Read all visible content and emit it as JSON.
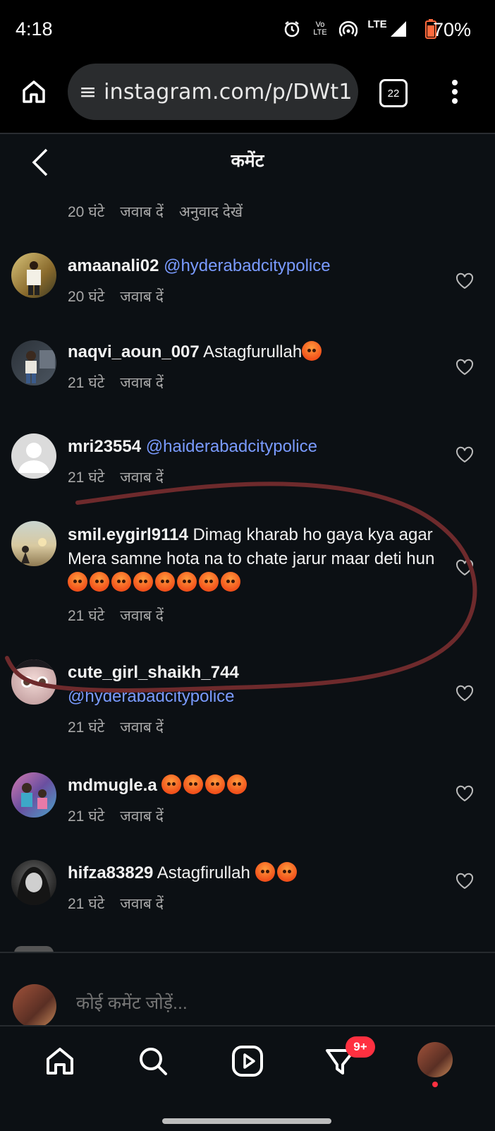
{
  "status_bar": {
    "time": "4:18",
    "volte": "Vo\nLTE",
    "lte": "LTE",
    "battery": "70%"
  },
  "browser": {
    "url": "≡ instagram.com/p/DWt1",
    "tabs_count": "22"
  },
  "header": {
    "title": "कमेंट"
  },
  "top_meta": {
    "time": "20 घंटे",
    "reply": "जवाब दें",
    "translate": "अनुवाद देखें"
  },
  "comments": [
    {
      "username": "amaanali02",
      "text": "",
      "mention": "@hyderabadcitypolice",
      "time": "20 घंटे",
      "reply": "जवाब दें"
    },
    {
      "username": "naqvi_aoun_007",
      "text": "Astagfurullah",
      "mention": "",
      "time": "21 घंटे",
      "reply": "जवाब दें",
      "emoji_count": 1
    },
    {
      "username": "mri23554",
      "text": "",
      "mention": "@haiderabadcitypolice",
      "time": "21 घंटे",
      "reply": "जवाब दें"
    },
    {
      "username": "smil.eygirl9114",
      "text": "Dimag kharab ho gaya kya agar Mera samne hota na to chate jarur maar deti hun",
      "mention": "",
      "time": "21 घंटे",
      "reply": "जवाब दें",
      "emoji_count": 8
    },
    {
      "username": "cute_girl_shaikh_744",
      "text": "",
      "mention": "@hyderabadcitypolice",
      "time": "21 घंटे",
      "reply": "जवाब दें"
    },
    {
      "username": "mdmugle.a",
      "text": "",
      "mention": "",
      "time": "21 घंटे",
      "reply": "जवाब दें",
      "emoji_count": 4
    },
    {
      "username": "hifza83829",
      "text": "Astagfirullah",
      "mention": "",
      "time": "21 घंटे",
      "reply": "जवाब दें",
      "emoji_count": 2
    }
  ],
  "compose": {
    "placeholder": "कोई कमेंट जोड़ें..."
  },
  "nav": {
    "activity_badge": "9+"
  },
  "colors": {
    "background": "#0c1014",
    "mention": "#7a9bff",
    "badge": "#ff3040",
    "annotation": "#6e2a2c"
  }
}
